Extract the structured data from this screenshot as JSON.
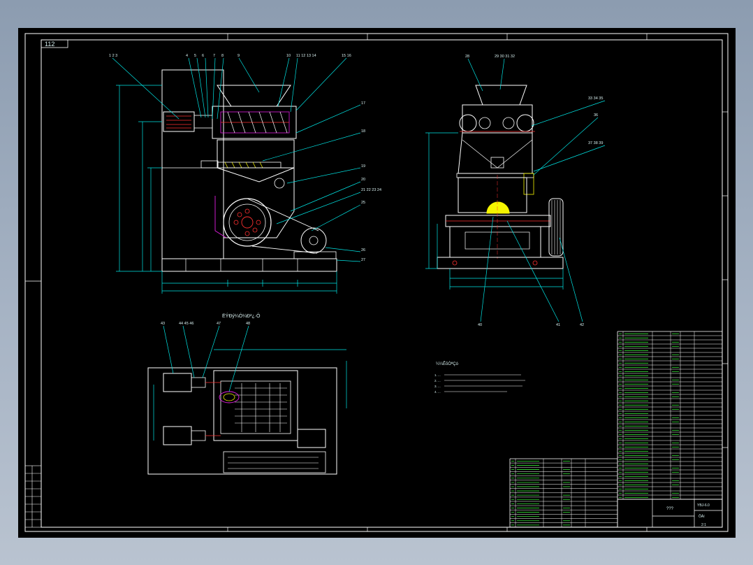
{
  "sheet": {
    "code": "112"
  },
  "colors": {
    "background": "#000000",
    "frame": "#ffffff",
    "cyan": "#00e5e5",
    "green": "#37e637",
    "magenta": "#e020e0",
    "red": "#ff3030",
    "yellow": "#f5f500",
    "white": "#ffffff"
  },
  "front_view": {
    "leader_labels": [
      "1 2 3",
      "4",
      "5",
      "6",
      "7",
      "8",
      "9",
      "10",
      "11 12 13 14",
      "15 16",
      "17",
      "18",
      "19",
      "20",
      "21 22 23 24",
      "25",
      "26",
      "27"
    ]
  },
  "side_view": {
    "leader_labels": [
      "28",
      "29 30 31 32",
      "33 34 35",
      "36",
      "37 38 39",
      "40",
      "41",
      "42"
    ]
  },
  "plan_view": {
    "title": "ËÝÐý¼Ó¼Ð²¿·Ö",
    "leader_labels": [
      "43",
      "44 45 46",
      "47",
      "48"
    ]
  },
  "notes": {
    "heading": "¼¼ÊõÒªÇó",
    "lines": [
      "1. ...",
      "2. ...",
      "3. ...",
      "4. ..."
    ]
  },
  "title_block": {
    "title": "???",
    "drawing_no": "YBJ-6.0",
    "material": "Ô­Àí",
    "scale": "2:1"
  }
}
